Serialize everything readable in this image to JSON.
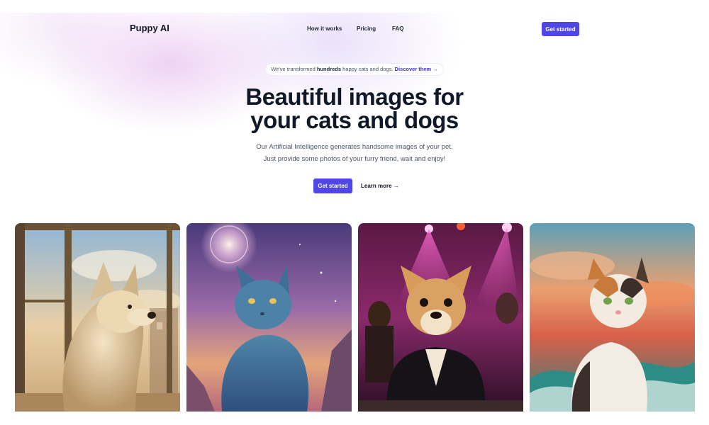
{
  "nav": {
    "brand": "Puppy AI",
    "links": [
      "How it works",
      "Pricing",
      "FAQ"
    ],
    "cta": "Get started"
  },
  "announcement": {
    "prefix": "We've transformed",
    "highlight": "hundreds",
    "suffix": "happy cats and dogs.",
    "link": "Discover them →"
  },
  "hero": {
    "title_line1": "Beautiful images for",
    "title_line2": "your cats and dogs",
    "subtitle_line1": "Our Artificial Intelligence generates handsome images of your pet.",
    "subtitle_line2": "Just provide some photos of your furry friend, wait and enjoy!",
    "cta": "Get started",
    "secondary": "Learn more →"
  },
  "gallery": [
    {
      "subject": "fluffy white dog by a window",
      "icon": "dog-portrait-image"
    },
    {
      "subject": "blue cat under a cosmic sky",
      "icon": "cat-portrait-image"
    },
    {
      "subject": "dog in a leather jacket at a concert",
      "icon": "dog-portrait-image"
    },
    {
      "subject": "calico cat by ocean waves",
      "icon": "cat-portrait-image"
    }
  ],
  "colors": {
    "accent": "#4f46e5",
    "link": "#4338ca",
    "heading": "#111827",
    "body": "#4b5563"
  }
}
